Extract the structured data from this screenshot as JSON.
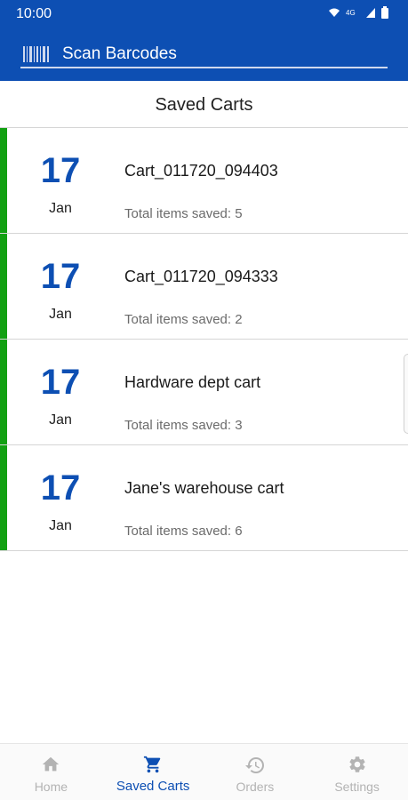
{
  "status_bar": {
    "time": "10:00"
  },
  "app_bar": {
    "title": "Scan Barcodes",
    "icon": "barcode-icon"
  },
  "section": {
    "title": "Saved Carts"
  },
  "colors": {
    "brand_blue": "#0d4fb3",
    "accent_green": "#12a012",
    "inactive_gray": "#b3b3b3"
  },
  "carts": [
    {
      "day": "17",
      "month": "Jan",
      "name": "Cart_011720_094403",
      "count": "Total items saved: 5"
    },
    {
      "day": "17",
      "month": "Jan",
      "name": "Cart_011720_094333",
      "count": "Total items saved: 2"
    },
    {
      "day": "17",
      "month": "Jan",
      "name": "Hardware dept cart",
      "count": "Total items saved: 3"
    },
    {
      "day": "17",
      "month": "Jan",
      "name": "Jane's warehouse cart",
      "count": "Total items saved: 6"
    }
  ],
  "bottom_nav": {
    "items": [
      {
        "label": "Home",
        "icon": "home-icon",
        "active": false
      },
      {
        "label": "Saved Carts",
        "icon": "cart-icon",
        "active": true
      },
      {
        "label": "Orders",
        "icon": "history-icon",
        "active": false
      },
      {
        "label": "Settings",
        "icon": "gear-icon",
        "active": false
      }
    ]
  }
}
